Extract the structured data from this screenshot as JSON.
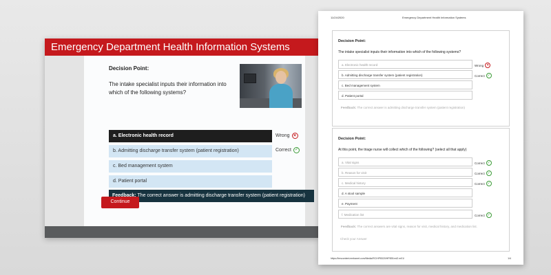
{
  "slide": {
    "header_title": "Emergency Department Health Information Systems",
    "decision_title": "Decision Point:",
    "question": "The intake specialist inputs their information into which of the following systems?",
    "options": [
      {
        "label": "a. Electronic health record",
        "selected": true,
        "result": "Wrong"
      },
      {
        "label": "b. Admitting discharge transfer system (patient registration)",
        "selected": false,
        "result": "Correct"
      },
      {
        "label": "c. Bed management system",
        "selected": false,
        "result": ""
      },
      {
        "label": "d. Patient portal",
        "selected": false,
        "result": ""
      }
    ],
    "feedback_label": "Feedback:",
    "feedback_text": "The correct answer is admitting discharge transfer system (patient registration)",
    "continue_label": "Continue",
    "photo_icon": "nurse-photo"
  },
  "doc": {
    "date": "11/24/2020",
    "title": "Emergency Department Health Information Systems",
    "card1": {
      "title": "Decision Point:",
      "question": "The intake specialist inputs their information into which of the following systems?",
      "options": [
        {
          "label": "a. Electronic health record",
          "result": "Wrong"
        },
        {
          "label": "b. Admitting discharge transfer system (patient registration)",
          "result": "Correct"
        },
        {
          "label": "c. Bed management system",
          "result": ""
        },
        {
          "label": "d. Patient portal",
          "result": ""
        }
      ],
      "feedback_label": "Feedback:",
      "feedback_text": "The correct answer is admitting discharge transfer system (patient registration)"
    },
    "card2": {
      "title": "Decision Point:",
      "question": "At this point, the triage nurse will collect which of the following? (select all that apply)",
      "options": [
        {
          "label": "a. Vital signs",
          "result": "Correct"
        },
        {
          "label": "b. Reason for visit",
          "result": "Correct"
        },
        {
          "label": "c. Medical history",
          "result": "Correct"
        },
        {
          "label": "d. A stool sample",
          "result": ""
        },
        {
          "label": "e. Payment",
          "result": ""
        },
        {
          "label": "f. Medication list",
          "result": "Correct"
        }
      ],
      "feedback_label": "Feedback:",
      "feedback_text": "The correct answers are vital signs, reason for visit, medical history, and medication list.",
      "check_label": "Check your Answer"
    },
    "footer_url": "https://lmscontent.embanet.com/Media/RC/HP8320/HP835.ed2.m01/",
    "page": "1/4"
  },
  "colors": {
    "brand_red": "#c5191d",
    "option_blue": "#d3e6f4",
    "feedback_navy": "#17333f",
    "correct_green": "#3a9b35"
  }
}
